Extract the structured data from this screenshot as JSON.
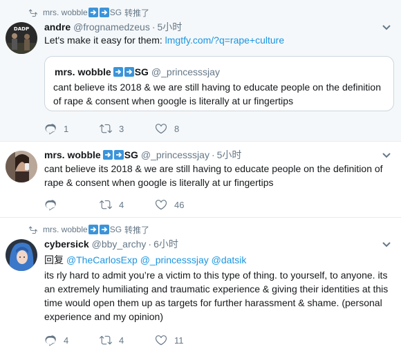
{
  "tweet1": {
    "retweet_by": "mrs. wobble",
    "retweet_tag": "SG",
    "retweet_suffix": "转推了",
    "author": "andre",
    "handle": "@frognamedzeus",
    "time": "5小时",
    "text_prefix": "Let's make it easy for them: ",
    "link": "lmgtfy.com/?q=rape+culture",
    "quote": {
      "author": "mrs. wobble",
      "tag": "SG",
      "handle": "@_princesssjay",
      "text": "cant believe its 2018 & we are still having to educate people on the definition of rape & consent when google is literally at ur fingertips"
    },
    "replies": "1",
    "retweets": "3",
    "likes": "8"
  },
  "tweet2": {
    "author": "mrs. wobble",
    "tag": "SG",
    "handle": "@_princesssjay",
    "time": "5小时",
    "text": "cant believe its 2018 & we are still having to educate people on the definition of rape & consent when google is literally at ur fingertips",
    "replies": "",
    "retweets": "4",
    "likes": "46"
  },
  "tweet3": {
    "retweet_by": "mrs. wobble",
    "retweet_tag": "SG",
    "retweet_suffix": "转推了",
    "author": "cybersick",
    "handle": "@bby_archy",
    "time": "6小时",
    "reply_prefix": "回复 ",
    "reply_to": [
      "@TheCarlosExp",
      "@_princesssjay",
      "@datsik"
    ],
    "text": "its rly hard to admit you’re a victim to this type of thing. to yourself, to anyone. its an extremely humiliating and traumatic experience & giving their identities at this time would open them up as targets for further harassment & shame. (personal experience and my opinion)",
    "replies": "4",
    "retweets": "4",
    "likes": "11"
  },
  "colors": {
    "link": "#1b95e0",
    "muted": "#657786",
    "emoji_bg": "#3b94d9"
  },
  "icons": [
    "retweet-icon",
    "arrow-right-emoji",
    "chevron-down-icon",
    "reply-icon",
    "like-icon"
  ]
}
